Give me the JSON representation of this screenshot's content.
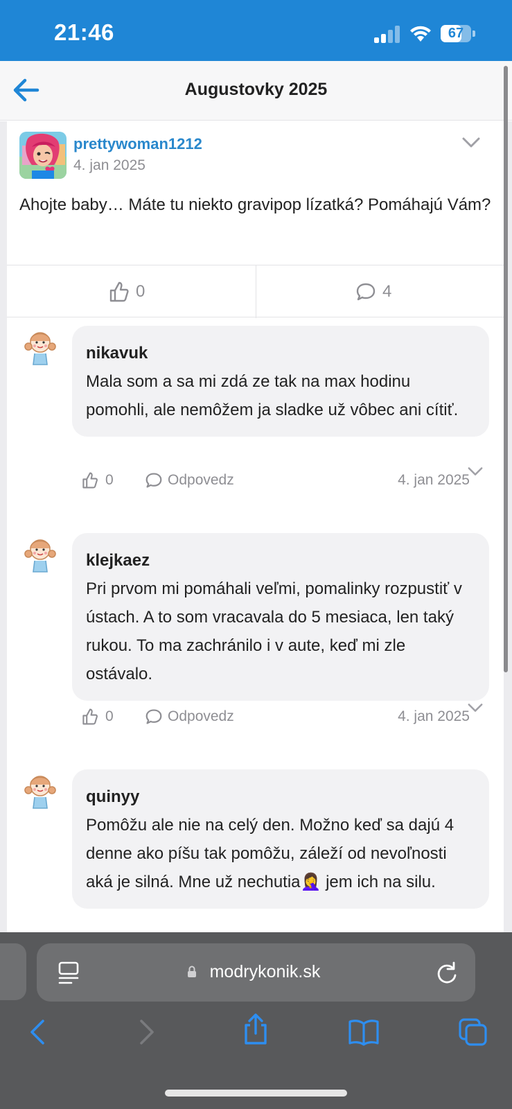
{
  "status": {
    "time": "21:46",
    "battery": "67",
    "battery_level": 0.67
  },
  "header": {
    "title": "Augustovky 2025"
  },
  "post": {
    "username": "prettywoman1212",
    "date": "4. jan 2025",
    "text": "Ahojte baby… Máte tu niekto gravipop lízatká? Pomáhajú Vám?",
    "likes": "0",
    "comments": "4"
  },
  "comments": [
    {
      "username": "nikavuk",
      "text": "Mala som a sa mi zdá ze tak na max hodinu pomohli, ale nemôžem ja sladke už vôbec ani cítiť.",
      "likes": "0",
      "reply_label": "Odpovedz",
      "date": "4. jan 2025"
    },
    {
      "username": "klejkaez",
      "text": "Pri prvom mi pomáhali veľmi, pomalinky rozpustiť v ústach. A to som vracavala do 5 mesiaca, len taký rukou. To ma zachránilo i v aute, keď mi zle ostávalo.",
      "likes": "0",
      "reply_label": "Odpovedz",
      "date": "4. jan 2025"
    },
    {
      "username": "quinyy",
      "text": "Pomôžu ale nie na celý den. Možno keď sa dajú 4 denne ako píšu tak pomôžu, záleží od nevoľnosti aká je silná. Mne už nechutia🤦‍♀️ jem ich na silu."
    }
  ],
  "browser": {
    "url": "modrykonik.sk"
  },
  "colors": {
    "accent": "#1f86d6",
    "link": "#2a88cc",
    "toolbar": "#58595b"
  }
}
